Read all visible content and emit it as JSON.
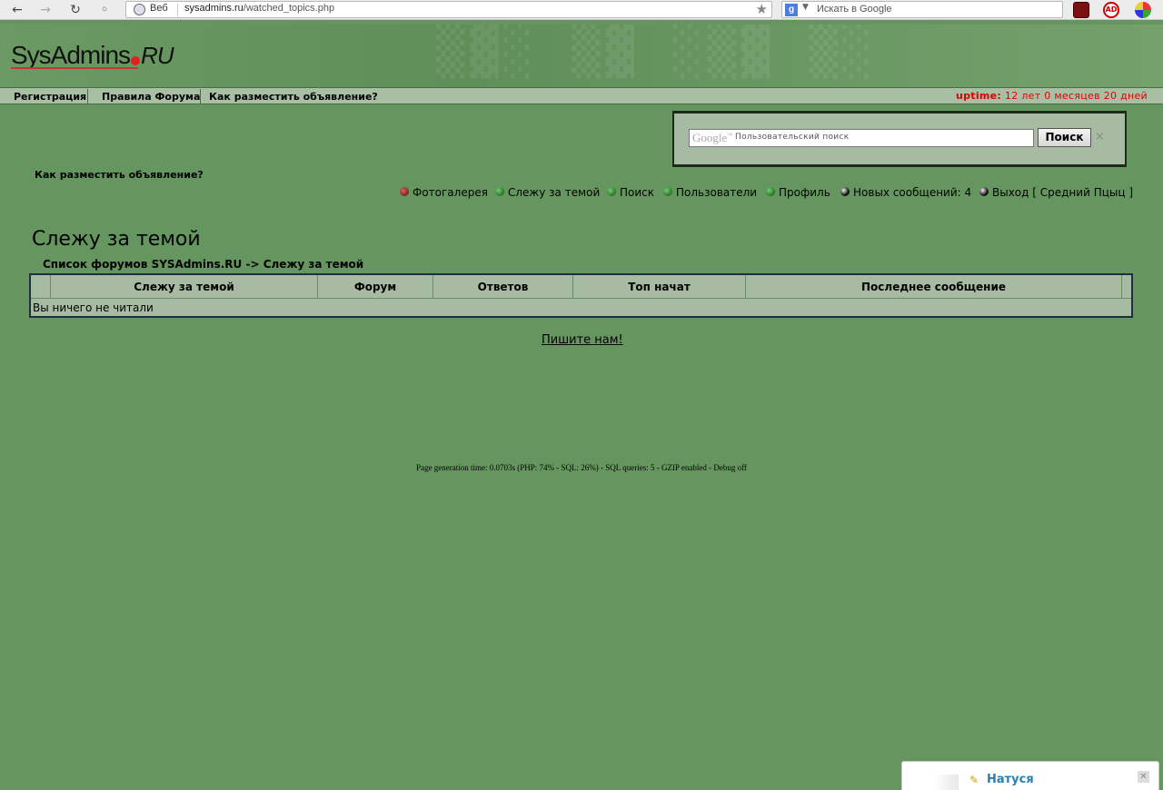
{
  "browser": {
    "scheme_label": "Веб",
    "url_host": "sysadmins.ru",
    "url_path": "/watched_topics.php",
    "search_placeholder": "Искать в Google"
  },
  "site": {
    "logo_main": "SysAdmins",
    "logo_tld": "RU"
  },
  "topnav": {
    "items": [
      "Регистрация",
      "Правила Форума",
      "Как разместить объявление?"
    ],
    "uptime_label": "uptime:",
    "uptime_value": "12 лет 0 месяцев 20 дней"
  },
  "cse": {
    "google_label": "Google",
    "placeholder": "Пользовательский поиск",
    "button": "Поиск",
    "close": "×"
  },
  "ad_link": "Как разместить объявление?",
  "usermenu": {
    "items": [
      "Фотогалерея",
      "Слежу за темой",
      "Поиск",
      "Пользователи",
      "Профиль",
      "Новых сообщений: 4",
      "Выход [ Средний Пцыц ]"
    ]
  },
  "page_title": "Слежу за темой",
  "breadcrumb": {
    "root": "Список форумов SYSAdmins.RU",
    "arrow": "->",
    "current": "Слежу за темой"
  },
  "table": {
    "headers": [
      "Слежу за темой",
      "Форум",
      "Ответов",
      "Топ начат",
      "Последнее сообщение"
    ],
    "empty_message": "Вы ничего не читали"
  },
  "contact_link": "Пишите нам!",
  "gen_info": "Page generation time: 0.0703s (PHP: 74% - SQL: 26%) - SQL queries: 5 - GZIP enabled - Debug off",
  "chat": {
    "name": "Натуся"
  },
  "colors": {
    "page_bg": "#66965f",
    "nav_bg": "#a9bfa3",
    "uptime": "#e00000",
    "table_border": "#1c3040",
    "chat_name": "#2a7fb0"
  }
}
